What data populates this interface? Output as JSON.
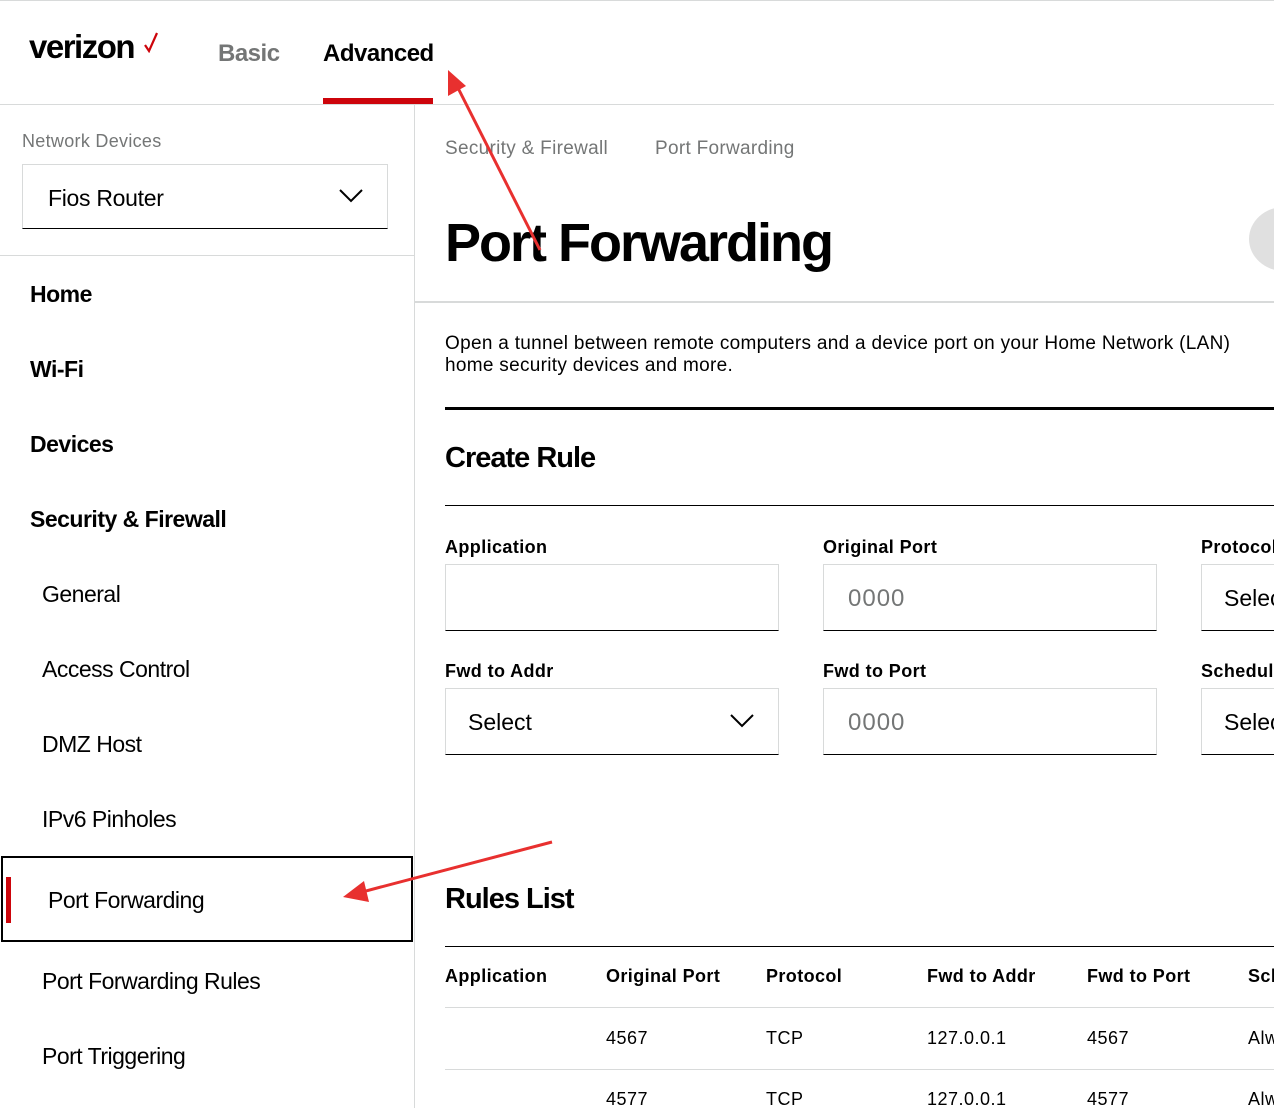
{
  "header": {
    "brand": "verizon",
    "tabs": [
      {
        "label": "Basic",
        "active": false
      },
      {
        "label": "Advanced",
        "active": true
      }
    ],
    "accent_color": "#cd040b"
  },
  "sidebar": {
    "network_devices_label": "Network Devices",
    "device_select_value": "Fios Router",
    "items": [
      {
        "label": "Home",
        "level": "top"
      },
      {
        "label": "Wi-Fi",
        "level": "top"
      },
      {
        "label": "Devices",
        "level": "top"
      },
      {
        "label": "Security & Firewall",
        "level": "top"
      },
      {
        "label": "General",
        "level": "sub"
      },
      {
        "label": "Access Control",
        "level": "sub"
      },
      {
        "label": "DMZ Host",
        "level": "sub"
      },
      {
        "label": "IPv6 Pinholes",
        "level": "sub"
      },
      {
        "label": "Port Forwarding",
        "level": "sub",
        "active": true
      },
      {
        "label": "Port Forwarding Rules",
        "level": "sub"
      },
      {
        "label": "Port Triggering",
        "level": "sub"
      }
    ]
  },
  "breadcrumb": [
    "Security & Firewall",
    "Port Forwarding"
  ],
  "main": {
    "title": "Port Forwarding",
    "description_line1": "Open a tunnel between remote computers and a device port on your Home Network (LAN)",
    "description_line2": "home security devices and more.",
    "create_rule": {
      "title": "Create Rule",
      "application_label": "Application",
      "application_value": "",
      "original_port_label": "Original Port",
      "original_port_placeholder": "0000",
      "protocol_label": "Protocol",
      "protocol_value": "Select",
      "fwd_addr_label": "Fwd to Addr",
      "fwd_addr_value": "Select",
      "fwd_port_label": "Fwd to Port",
      "fwd_port_placeholder": "0000",
      "schedule_label": "Schedule",
      "schedule_value": "Select"
    },
    "rules_list": {
      "title": "Rules List",
      "columns": [
        "Application",
        "Original Port",
        "Protocol",
        "Fwd to Addr",
        "Fwd to Port",
        "Schedule"
      ],
      "rows": [
        [
          "",
          "4567",
          "TCP",
          "127.0.0.1",
          "4567",
          "Always"
        ],
        [
          "",
          "4577",
          "TCP",
          "127.0.0.1",
          "4577",
          "Always"
        ]
      ]
    }
  },
  "annotations": {
    "arrow_color": "#e8302f"
  }
}
